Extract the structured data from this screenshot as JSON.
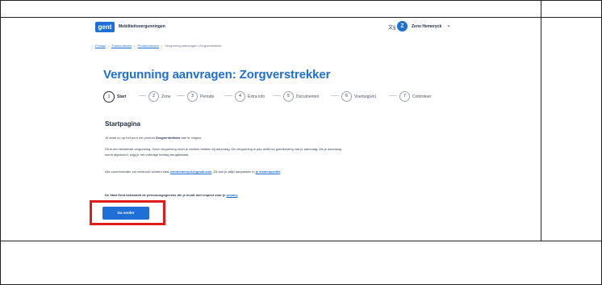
{
  "header": {
    "logo_text": "gent",
    "app_title": "Mobiliteitsvergunningen",
    "language_icon": "language-icon",
    "user_initial": "Z",
    "user_name": "Zeno Hemeryck",
    "dropdown_icon": "chevron-down-icon"
  },
  "breadcrumb": {
    "items": [
      "Portaal",
      "Thema kiezen",
      "Product kiezen",
      "Vergunning aanvragen: Zorgverstrekker"
    ]
  },
  "page": {
    "title": "Vergunning aanvragen: Zorgverstrekker"
  },
  "steps": [
    {
      "num": "1",
      "label": "Start"
    },
    {
      "num": "2",
      "label": "Zone"
    },
    {
      "num": "3",
      "label": "Periode"
    },
    {
      "num": "4",
      "label": "Extra info"
    },
    {
      "num": "5",
      "label": "Documenten"
    },
    {
      "num": "6",
      "label": "Voertuig(en)"
    },
    {
      "num": "7",
      "label": "Controleer"
    }
  ],
  "content": {
    "section_title": "Startpagina",
    "p1_pre": "Je staat nu op het punt om product ",
    "p1_bold": "Zorgverstrekker",
    "p1_post": " aan te vragen.",
    "p2": "Dit is een betalende vergunning. Deze vergunning moet je meteen betalen bij aanvraag. De vergunning is pas actief na goedkeuring van je aanvraag. Als je aanvraag wordt afgekeurd, krijg je het volledige bedrag terugbetaald.",
    "p3_pre": "Alle communicatie zal verstuurd worden naar ",
    "p3_email": "zenohemeryck@gmail.com",
    "p3_mid": ". Dit kan je altijd aanpassen in ",
    "p3_link": "je klantenprofiel",
    "p3_post": ".",
    "p4_pre": "De Stad Gent behandelt de persoonsgegevens die je invult met respect voor je ",
    "p4_link": "privacy",
    "p4_post": ".",
    "next_button": "Ga verder"
  },
  "colors": {
    "accent": "#1f6fd6",
    "highlight": "#e21b1b"
  }
}
